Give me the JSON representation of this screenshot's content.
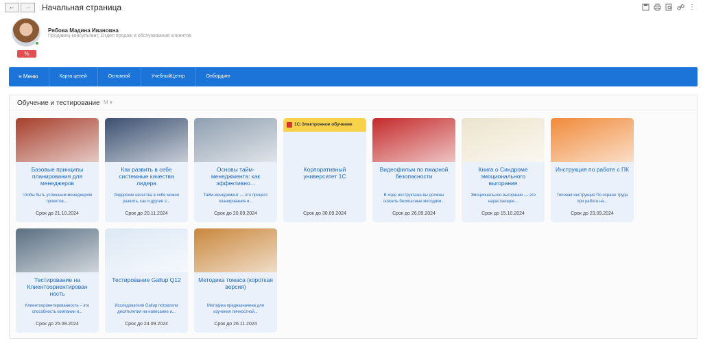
{
  "window": {
    "title": "Начальная страница",
    "nav_back": "←",
    "nav_forward": "→",
    "tools": [
      "save-icon",
      "print-icon",
      "preview-icon",
      "link-icon",
      "more-icon"
    ]
  },
  "profile": {
    "name": "Рябова Мадина Ивановна",
    "role": "Продавец-консультант, Отдел продаж и обслуживания клиентов",
    "badge": "%"
  },
  "menu": {
    "items": [
      "Меню",
      "Карта целей",
      "Основной",
      "УчебныйЦентр",
      "Онбординг"
    ]
  },
  "section": {
    "title": "Обучение и тестирование",
    "icons": "M ▾"
  },
  "cards": [
    {
      "title": "Базовые принципы планирования для менеджеров",
      "desc": "Чтобы быть успешным менеджером проектов,...",
      "date": "Срок до 21.10.2024",
      "img_color": "#a63f2c"
    },
    {
      "title": "Как развить в себе системные качества лидера",
      "desc": "Лидерские качества в себе можно развить, как и другие s...",
      "date": "Срок до 20.11.2024",
      "img_color": "#3a4f70"
    },
    {
      "title": "Основы тайм-менеджмента: как эффективно...",
      "desc": "Тайм-менеджмент — это процесс планирования и...",
      "date": "Срок до 20.09.2024",
      "img_color": "#8f9fb0"
    },
    {
      "title": "Корпоративный университет 1С",
      "desc": "",
      "date": "Срок до 30.09.2024",
      "banner": "1С:Электронное обучение"
    },
    {
      "title": "Видеофильм по пжарной безопасности",
      "desc": "В ходе инструктажа вы должны освоить безопасные методики...",
      "date": "Срок до 26.09.2024",
      "img_color": "#c42a2a"
    },
    {
      "title": "Книга о Синдроме эмоционального выгорания",
      "desc": "Эмоциональное выгорание — это нарастающее...",
      "date": "Срок до 15.10.2024",
      "img_color": "#ece4cc"
    },
    {
      "title": "Инструкция по работе с ПК",
      "desc": "Типовая инструкция По охране труда при работе на...",
      "date": "Срок до 23.09.2024",
      "img_color": "#f08a3a"
    },
    {
      "title": "Тестирование на Клиентоориентирован ность",
      "desc": "Клиентоориентированность – это способность компании и...",
      "date": "Срок до 25.09.2024",
      "img_color": "#5a6f82"
    },
    {
      "title": "Тестирование Gallup Q12",
      "desc": "Исследователи Gallup потратили десятилетия на написание и...",
      "date": "Срок до 24.09.2024",
      "img_color": "#dce8f5"
    },
    {
      "title": "Методика томаса (короткая версия)",
      "desc": "Методика предназначена для изучения личностной...",
      "date": "Срок до 26.11.2024",
      "img_color": "#c9873c"
    }
  ]
}
